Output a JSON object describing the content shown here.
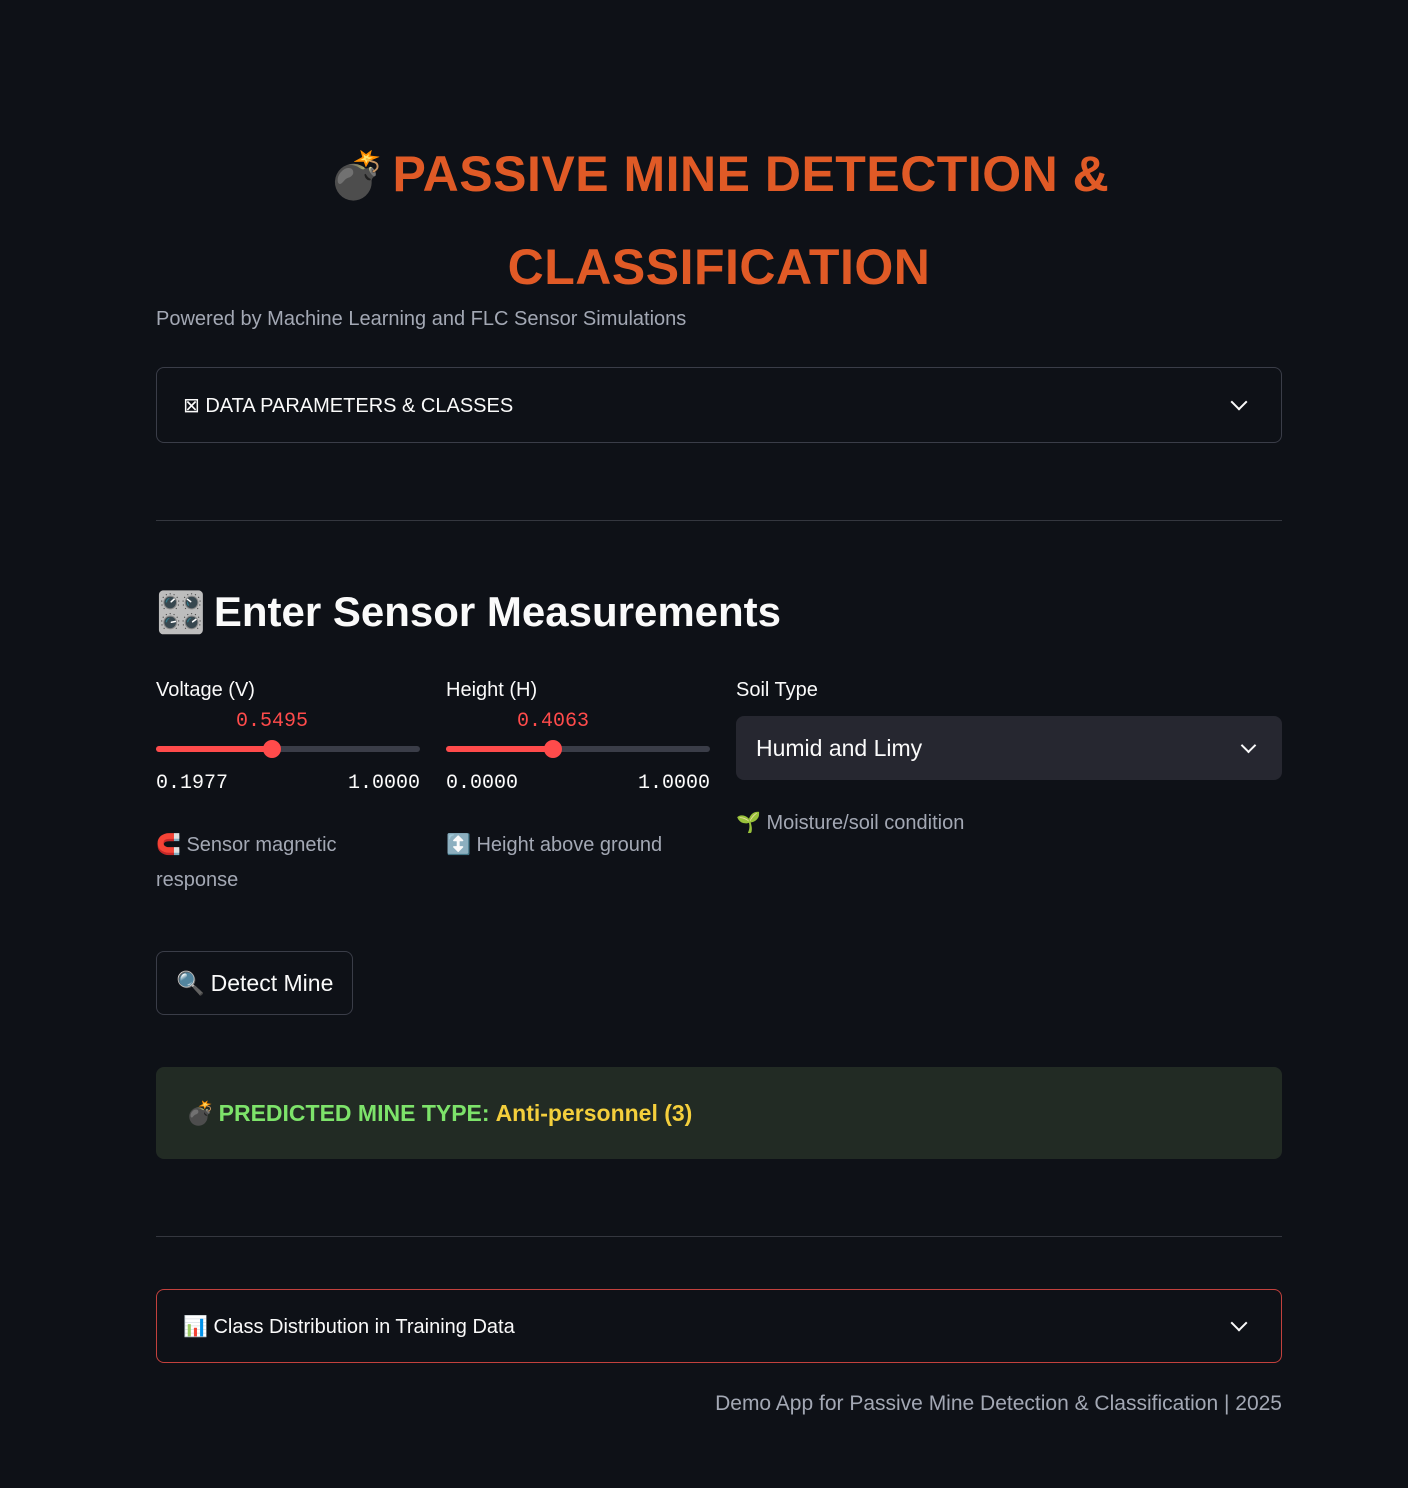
{
  "title": {
    "emoji": "💣",
    "text": "PASSIVE MINE DETECTION & CLASSIFICATION"
  },
  "subtitle": "Powered by Machine Learning and FLC Sensor Simulations",
  "expander_params": {
    "icon": "⊠",
    "label": "DATA PARAMETERS & CLASSES"
  },
  "section": {
    "emoji": "🎛️",
    "heading": "Enter Sensor Measurements"
  },
  "voltage": {
    "label": "Voltage (V)",
    "value": "0.5495",
    "min": "0.1977",
    "max": "1.0000",
    "fraction": 0.4389,
    "helper": "🧲 Sensor magnetic response"
  },
  "height": {
    "label": "Height (H)",
    "value": "0.4063",
    "min": "0.0000",
    "max": "1.0000",
    "fraction": 0.4063,
    "helper": "↕️ Height above ground"
  },
  "soil": {
    "label": "Soil Type",
    "selected": "Humid and Limy",
    "helper": "🌱 Moisture/soil condition"
  },
  "detect_button": {
    "emoji": "🔍",
    "label": "Detect Mine"
  },
  "prediction": {
    "emoji": "💣",
    "label": "PREDICTED MINE TYPE:",
    "value": "Anti-personnel (3)"
  },
  "expander_dist": {
    "icon": "📊",
    "label": "Class Distribution in Training Data"
  },
  "footer": "Demo App for Passive Mine Detection & Classification | 2025",
  "colors": {
    "accent": "#ff4b4b",
    "title": "#e05a26",
    "success_text": "#7de36a",
    "warning_text": "#f4cf3c"
  }
}
